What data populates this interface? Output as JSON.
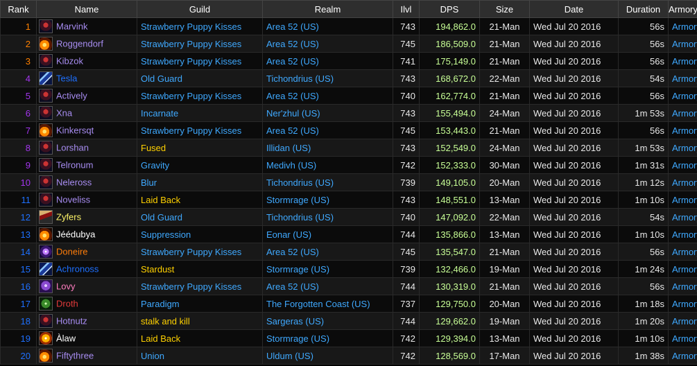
{
  "colors": {
    "header_bg": "#2e2e2e",
    "link_blue": "#3fa9ff",
    "dps_green": "#c8ff96"
  },
  "headers": [
    "Rank",
    "Name",
    "Guild",
    "Realm",
    "Ilvl",
    "DPS",
    "Size",
    "Date",
    "Duration",
    "Armory"
  ],
  "rows": [
    {
      "rank": "1",
      "name": "Marvink",
      "name_color": "#a78cf0",
      "rank_color": "#ff8000",
      "icon": "demon-icon",
      "icon_class": "icon-demon",
      "guild": "Strawberry Puppy Kisses",
      "guild_color": "#3fa9ff",
      "realm": "Area 52 (US)",
      "ilvl": "743",
      "dps": "194,862.0",
      "size": "21-Man",
      "date": "Wed Jul 20 2016",
      "duration": "56s",
      "armory": "Armory"
    },
    {
      "rank": "2",
      "name": "Roggendorf",
      "name_color": "#a78cf0",
      "rank_color": "#ff8000",
      "icon": "fire-icon",
      "icon_class": "icon-fire",
      "guild": "Strawberry Puppy Kisses",
      "guild_color": "#3fa9ff",
      "realm": "Area 52 (US)",
      "ilvl": "745",
      "dps": "186,509.0",
      "size": "21-Man",
      "date": "Wed Jul 20 2016",
      "duration": "56s",
      "armory": "Armory"
    },
    {
      "rank": "3",
      "name": "Kibzok",
      "name_color": "#a78cf0",
      "rank_color": "#ff8000",
      "icon": "demon-icon",
      "icon_class": "icon-demon",
      "guild": "Strawberry Puppy Kisses",
      "guild_color": "#3fa9ff",
      "realm": "Area 52 (US)",
      "ilvl": "741",
      "dps": "175,149.0",
      "size": "21-Man",
      "date": "Wed Jul 20 2016",
      "duration": "56s",
      "armory": "Armory"
    },
    {
      "rank": "4",
      "name": "Tesla",
      "name_color": "#1e70ff",
      "rank_color": "#a335ee",
      "icon": "lightning-icon",
      "icon_class": "icon-lightning",
      "guild": "Old Guard",
      "guild_color": "#3fa9ff",
      "realm": "Tichondrius (US)",
      "ilvl": "743",
      "dps": "168,672.0",
      "size": "22-Man",
      "date": "Wed Jul 20 2016",
      "duration": "54s",
      "armory": "Armory"
    },
    {
      "rank": "5",
      "name": "Actively",
      "name_color": "#a78cf0",
      "rank_color": "#a335ee",
      "icon": "demon-icon",
      "icon_class": "icon-demon",
      "guild": "Strawberry Puppy Kisses",
      "guild_color": "#3fa9ff",
      "realm": "Area 52 (US)",
      "ilvl": "740",
      "dps": "162,774.0",
      "size": "21-Man",
      "date": "Wed Jul 20 2016",
      "duration": "56s",
      "armory": "Armory"
    },
    {
      "rank": "6",
      "name": "Xna",
      "name_color": "#a78cf0",
      "rank_color": "#a335ee",
      "icon": "demon-icon",
      "icon_class": "icon-demon",
      "guild": "Incarnate",
      "guild_color": "#3fa9ff",
      "realm": "Ner'zhul (US)",
      "ilvl": "743",
      "dps": "155,494.0",
      "size": "24-Man",
      "date": "Wed Jul 20 2016",
      "duration": "1m 53s",
      "armory": "Armory"
    },
    {
      "rank": "7",
      "name": "Kinkersqt",
      "name_color": "#a78cf0",
      "rank_color": "#a335ee",
      "icon": "fire-icon",
      "icon_class": "icon-fire",
      "guild": "Strawberry Puppy Kisses",
      "guild_color": "#3fa9ff",
      "realm": "Area 52 (US)",
      "ilvl": "745",
      "dps": "153,443.0",
      "size": "21-Man",
      "date": "Wed Jul 20 2016",
      "duration": "56s",
      "armory": "Armory"
    },
    {
      "rank": "8",
      "name": "Lorshan",
      "name_color": "#a78cf0",
      "rank_color": "#a335ee",
      "icon": "demon-icon",
      "icon_class": "icon-demon",
      "guild": "Fused",
      "guild_color": "#ffd100",
      "realm": "Illidan (US)",
      "ilvl": "743",
      "dps": "152,549.0",
      "size": "24-Man",
      "date": "Wed Jul 20 2016",
      "duration": "1m 53s",
      "armory": "Armory"
    },
    {
      "rank": "9",
      "name": "Telronum",
      "name_color": "#a78cf0",
      "rank_color": "#a335ee",
      "icon": "demon-icon",
      "icon_class": "icon-demon",
      "guild": "Gravity",
      "guild_color": "#3fa9ff",
      "realm": "Medivh (US)",
      "ilvl": "742",
      "dps": "152,333.0",
      "size": "30-Man",
      "date": "Wed Jul 20 2016",
      "duration": "1m 31s",
      "armory": "Armory"
    },
    {
      "rank": "10",
      "name": "Neleross",
      "name_color": "#a78cf0",
      "rank_color": "#a335ee",
      "icon": "demon-icon",
      "icon_class": "icon-demon",
      "guild": "Blur",
      "guild_color": "#3fa9ff",
      "realm": "Tichondrius (US)",
      "ilvl": "739",
      "dps": "149,105.0",
      "size": "20-Man",
      "date": "Wed Jul 20 2016",
      "duration": "1m 12s",
      "armory": "Armory"
    },
    {
      "rank": "11",
      "name": "Noveliss",
      "name_color": "#a78cf0",
      "rank_color": "#1e70ff",
      "icon": "demon-icon",
      "icon_class": "icon-demon",
      "guild": "Laid Back",
      "guild_color": "#ffd100",
      "realm": "Stormrage (US)",
      "ilvl": "743",
      "dps": "148,551.0",
      "size": "13-Man",
      "date": "Wed Jul 20 2016",
      "duration": "1m 10s",
      "armory": "Armory"
    },
    {
      "rank": "12",
      "name": "Zyfers",
      "name_color": "#fff569",
      "rank_color": "#1e70ff",
      "icon": "rogue-icon",
      "icon_class": "icon-rogue",
      "guild": "Old Guard",
      "guild_color": "#3fa9ff",
      "realm": "Tichondrius (US)",
      "ilvl": "740",
      "dps": "147,092.0",
      "size": "22-Man",
      "date": "Wed Jul 20 2016",
      "duration": "54s",
      "armory": "Armory"
    },
    {
      "rank": "13",
      "name": "Jéédubya",
      "name_color": "#ffffff",
      "rank_color": "#1e70ff",
      "icon": "fire-icon",
      "icon_class": "icon-fire",
      "guild": "Suppression",
      "guild_color": "#3fa9ff",
      "realm": "Eonar (US)",
      "ilvl": "744",
      "dps": "135,866.0",
      "size": "13-Man",
      "date": "Wed Jul 20 2016",
      "duration": "1m 10s",
      "armory": "Armory"
    },
    {
      "rank": "14",
      "name": "Doneire",
      "name_color": "#ff7d0a",
      "rank_color": "#1e70ff",
      "icon": "arcane-icon",
      "icon_class": "icon-arcane",
      "guild": "Strawberry Puppy Kisses",
      "guild_color": "#3fa9ff",
      "realm": "Area 52 (US)",
      "ilvl": "745",
      "dps": "135,547.0",
      "size": "21-Man",
      "date": "Wed Jul 20 2016",
      "duration": "56s",
      "armory": "Armory"
    },
    {
      "rank": "15",
      "name": "Achronoss",
      "name_color": "#1e70ff",
      "rank_color": "#1e70ff",
      "icon": "lightning-icon",
      "icon_class": "icon-lightning",
      "guild": "Stardust",
      "guild_color": "#ffd100",
      "realm": "Stormrage (US)",
      "ilvl": "739",
      "dps": "132,466.0",
      "size": "19-Man",
      "date": "Wed Jul 20 2016",
      "duration": "1m 24s",
      "armory": "Armory"
    },
    {
      "rank": "16",
      "name": "Lovy",
      "name_color": "#ff7dc0",
      "rank_color": "#1e70ff",
      "icon": "shadow-icon",
      "icon_class": "icon-shadow",
      "guild": "Strawberry Puppy Kisses",
      "guild_color": "#3fa9ff",
      "realm": "Area 52 (US)",
      "ilvl": "744",
      "dps": "130,319.0",
      "size": "21-Man",
      "date": "Wed Jul 20 2016",
      "duration": "56s",
      "armory": "Armory"
    },
    {
      "rank": "17",
      "name": "Droth",
      "name_color": "#e23b3b",
      "rank_color": "#1e70ff",
      "icon": "warlock-icon",
      "icon_class": "icon-warlock",
      "guild": "Paradigm",
      "guild_color": "#3fa9ff",
      "realm": "The Forgotten Coast (US)",
      "ilvl": "737",
      "dps": "129,750.0",
      "size": "20-Man",
      "date": "Wed Jul 20 2016",
      "duration": "1m 18s",
      "armory": "Armory"
    },
    {
      "rank": "18",
      "name": "Hotnutz",
      "name_color": "#a78cf0",
      "rank_color": "#1e70ff",
      "icon": "demon-icon",
      "icon_class": "icon-demon",
      "guild": "stalk and kill",
      "guild_color": "#ffd100",
      "realm": "Sargeras (US)",
      "ilvl": "744",
      "dps": "129,662.0",
      "size": "19-Man",
      "date": "Wed Jul 20 2016",
      "duration": "1m 20s",
      "armory": "Armory"
    },
    {
      "rank": "19",
      "name": "Àlaw",
      "name_color": "#ffffff",
      "rank_color": "#1e70ff",
      "icon": "flame-skull-icon",
      "icon_class": "icon-flame-skull",
      "guild": "Laid Back",
      "guild_color": "#ffd100",
      "realm": "Stormrage (US)",
      "ilvl": "742",
      "dps": "129,394.0",
      "size": "13-Man",
      "date": "Wed Jul 20 2016",
      "duration": "1m 10s",
      "armory": "Armory"
    },
    {
      "rank": "20",
      "name": "Fiftythree",
      "name_color": "#a78cf0",
      "rank_color": "#1e70ff",
      "icon": "fire-icon",
      "icon_class": "icon-fire",
      "guild": "Union",
      "guild_color": "#3fa9ff",
      "realm": "Uldum (US)",
      "ilvl": "742",
      "dps": "128,569.0",
      "size": "17-Man",
      "date": "Wed Jul 20 2016",
      "duration": "1m 38s",
      "armory": "Armory"
    }
  ]
}
